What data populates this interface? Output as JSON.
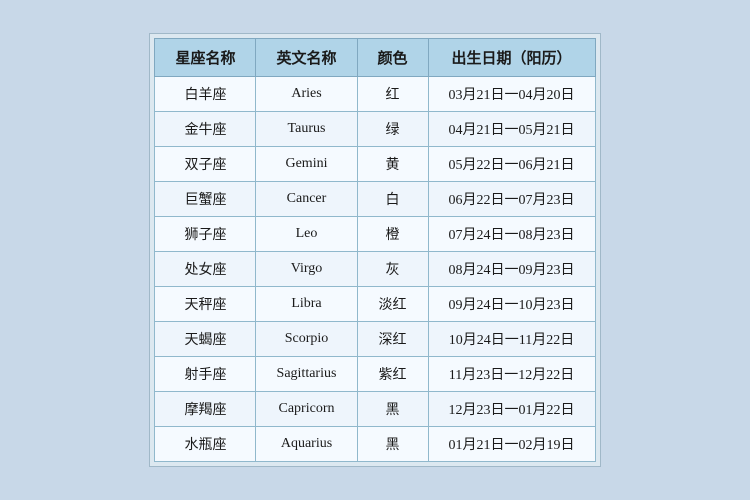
{
  "table": {
    "headers": [
      "星座名称",
      "英文名称",
      "颜色",
      "出生日期（阳历）"
    ],
    "rows": [
      {
        "chinese": "白羊座",
        "english": "Aries",
        "color": "红",
        "dates": "03月21日一04月20日"
      },
      {
        "chinese": "金牛座",
        "english": "Taurus",
        "color": "绿",
        "dates": "04月21日一05月21日"
      },
      {
        "chinese": "双子座",
        "english": "Gemini",
        "color": "黄",
        "dates": "05月22日一06月21日"
      },
      {
        "chinese": "巨蟹座",
        "english": "Cancer",
        "color": "白",
        "dates": "06月22日一07月23日"
      },
      {
        "chinese": "狮子座",
        "english": "Leo",
        "color": "橙",
        "dates": "07月24日一08月23日"
      },
      {
        "chinese": "处女座",
        "english": "Virgo",
        "color": "灰",
        "dates": "08月24日一09月23日"
      },
      {
        "chinese": "天秤座",
        "english": "Libra",
        "color": "淡红",
        "dates": "09月24日一10月23日"
      },
      {
        "chinese": "天蝎座",
        "english": "Scorpio",
        "color": "深红",
        "dates": "10月24日一11月22日"
      },
      {
        "chinese": "射手座",
        "english": "Sagittarius",
        "color": "紫红",
        "dates": "11月23日一12月22日"
      },
      {
        "chinese": "摩羯座",
        "english": "Capricorn",
        "color": "黑",
        "dates": "12月23日一01月22日"
      },
      {
        "chinese": "水瓶座",
        "english": "Aquarius",
        "color": "黑",
        "dates": "01月21日一02月19日"
      }
    ]
  }
}
